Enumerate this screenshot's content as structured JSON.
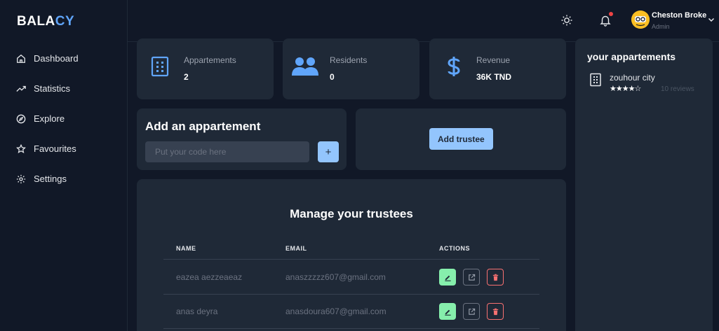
{
  "brand": {
    "prefix": "BALA",
    "accent": "CY"
  },
  "sidebar": {
    "items": [
      {
        "label": "Dashboard"
      },
      {
        "label": "Statistics"
      },
      {
        "label": "Explore"
      },
      {
        "label": "Favourites"
      },
      {
        "label": "Settings"
      }
    ]
  },
  "topbar": {
    "user": {
      "name": "Cheston Broke",
      "role": "Admin"
    }
  },
  "stats": [
    {
      "label": "Appartements",
      "value": "2"
    },
    {
      "label": "Residents",
      "value": "0"
    },
    {
      "label": "Revenue",
      "value": "36K TND"
    }
  ],
  "add_appartement": {
    "title": "Add an appartement",
    "placeholder": "Put your code here",
    "add_label": "+"
  },
  "trustee": {
    "button_label": "Add trustee"
  },
  "manage": {
    "title": "Manage your trustees",
    "columns": [
      "NAME",
      "EMAIL",
      "ACTIONS"
    ],
    "rows": [
      {
        "name": "eazea aezzeaeaz",
        "email": "anaszzzzz607@gmail.com"
      },
      {
        "name": "anas deyra",
        "email": "anasdoura607@gmail.com"
      }
    ]
  },
  "your_appartements": {
    "title": "your appartements",
    "items": [
      {
        "name": "zouhour city",
        "stars": "★★★★☆",
        "reviews": "10 reviews"
      }
    ]
  },
  "colors": {
    "background": "#111827",
    "card": "#1f2937",
    "accent": "#60a5fa",
    "button": "#93c5fd",
    "edit": "#86efac",
    "delete": "#f87171",
    "notification": "#ef4444"
  },
  "icons": {
    "sidebar": [
      "home-icon",
      "trending-up-icon",
      "compass-icon",
      "star-icon",
      "gear-icon"
    ],
    "stats": [
      "building-icon",
      "users-icon",
      "dollar-icon"
    ],
    "top": [
      "sun-icon",
      "bell-icon",
      "chevron-down-icon"
    ],
    "actions": [
      "edit-icon",
      "external-link-icon",
      "trash-icon"
    ]
  }
}
